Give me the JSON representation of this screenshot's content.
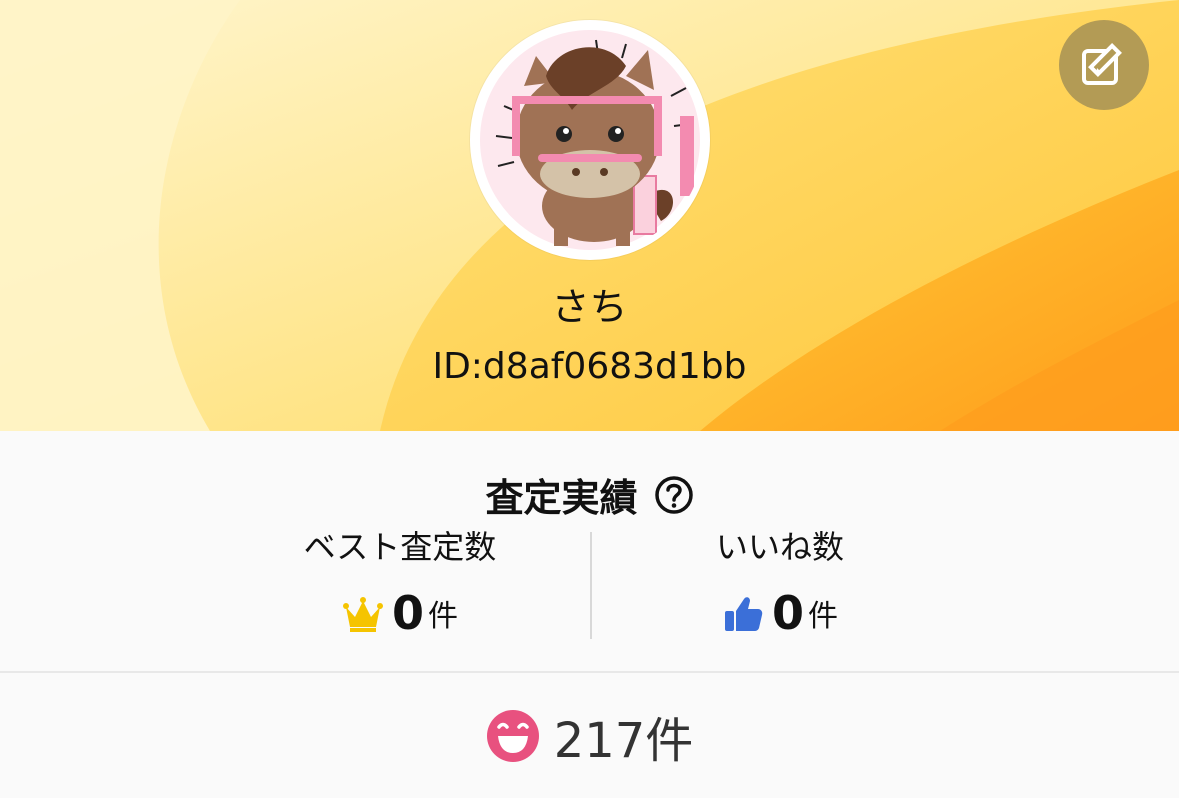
{
  "profile": {
    "name": "さち",
    "id_text": "ID:d8af0683d1bb",
    "avatar_icon": "horse-character-avatar",
    "edit_icon": "edit-pencil-icon"
  },
  "stats": {
    "title": "査定実績",
    "help_icon": "question-circle-icon",
    "best": {
      "label": "ベスト査定数",
      "icon": "crown-icon",
      "value": "0",
      "unit": "件"
    },
    "likes": {
      "label": "いいね数",
      "icon": "thumbs-up-icon",
      "value": "0",
      "unit": "件"
    }
  },
  "reactions": {
    "icon": "smile-face-icon",
    "count_text": "217件"
  },
  "colors": {
    "header_gradient_start": "#fff3c4",
    "header_gradient_end": "#ffb21c",
    "edit_button_bg": "#b39b55",
    "crown": "#f5c400",
    "thumbs_up": "#3b6fd8",
    "smile": "#e8517f"
  }
}
